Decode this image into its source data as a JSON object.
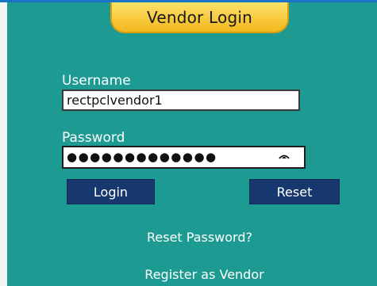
{
  "header": {
    "title": "Vendor Login"
  },
  "form": {
    "username_label": "Username",
    "username_value": "rectpclvendor1",
    "password_label": "Password",
    "password_masked": "●●●●●●●●●●●●●",
    "password_toggle_icon": "eye-icon"
  },
  "buttons": {
    "login": "Login",
    "reset": "Reset"
  },
  "links": {
    "reset_password": "Reset Password?",
    "register": "Register as Vendor"
  },
  "colors": {
    "panel": "#1d9b92",
    "header_tab": "#f7c531",
    "button": "#17386e",
    "top_border": "#1a74c8"
  }
}
